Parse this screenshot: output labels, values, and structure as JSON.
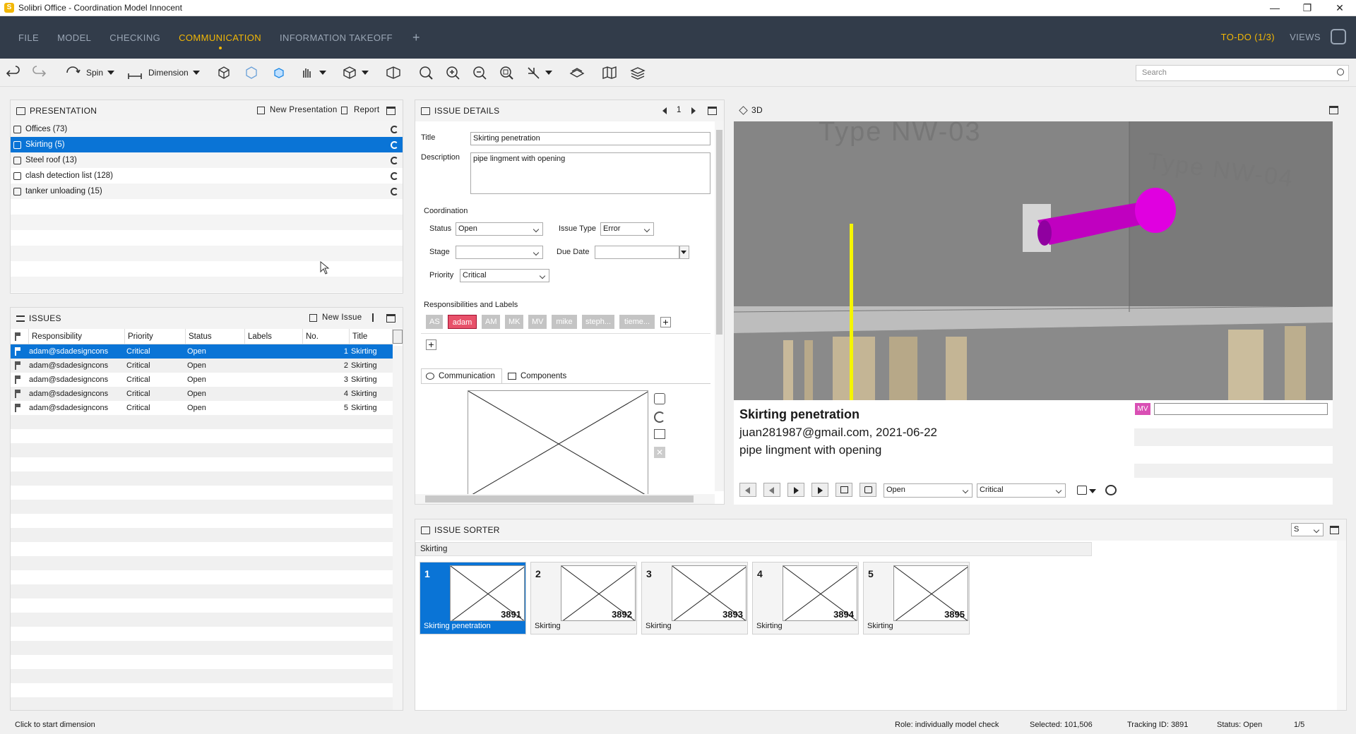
{
  "window": {
    "title": "Solibri Office - Coordination Model Innocent",
    "logo_letter": "S"
  },
  "menu": {
    "items": [
      "FILE",
      "MODEL",
      "CHECKING",
      "COMMUNICATION",
      "INFORMATION TAKEOFF"
    ],
    "active": "COMMUNICATION",
    "plus": "+",
    "todo": "TO-DO (1/3)",
    "views": "VIEWS"
  },
  "toolbar": {
    "spin_label": "Spin",
    "dimension_label": "Dimension",
    "search_placeholder": "Search"
  },
  "presentation": {
    "header": "PRESENTATION",
    "new_label": "New Presentation",
    "report_label": "Report",
    "items": [
      {
        "label": "Offices (73)"
      },
      {
        "label": "Skirting (5)"
      },
      {
        "label": "Steel roof (13)"
      },
      {
        "label": "clash detection list (128)"
      },
      {
        "label": "tanker unloading (15)"
      }
    ],
    "selected_index": 1
  },
  "issues": {
    "header": "ISSUES",
    "new_label": "New Issue",
    "columns": [
      "Responsibility",
      "Priority",
      "Status",
      "Labels",
      "No.",
      "Title"
    ],
    "rows": [
      {
        "responsibility": "adam@sdadesigncons",
        "priority": "Critical",
        "status": "Open",
        "labels": "",
        "no": "1",
        "title": "Skirting"
      },
      {
        "responsibility": "adam@sdadesigncons",
        "priority": "Critical",
        "status": "Open",
        "labels": "",
        "no": "2",
        "title": "Skirting"
      },
      {
        "responsibility": "adam@sdadesigncons",
        "priority": "Critical",
        "status": "Open",
        "labels": "",
        "no": "3",
        "title": "Skirting"
      },
      {
        "responsibility": "adam@sdadesigncons",
        "priority": "Critical",
        "status": "Open",
        "labels": "",
        "no": "4",
        "title": "Skirting"
      },
      {
        "responsibility": "adam@sdadesigncons",
        "priority": "Critical",
        "status": "Open",
        "labels": "",
        "no": "5",
        "title": "Skirting"
      }
    ]
  },
  "details": {
    "header": "ISSUE DETAILS",
    "page": "1",
    "title_label": "Title",
    "title_value": "Skirting penetration",
    "description_label": "Description",
    "description_value": "pipe lingment with opening",
    "coordination_label": "Coordination",
    "status_label": "Status",
    "status_value": "Open",
    "issue_type_label": "Issue Type",
    "issue_type_value": "Error",
    "stage_label": "Stage",
    "stage_value": "",
    "due_date_label": "Due Date",
    "due_date_value": "",
    "priority_label": "Priority",
    "priority_value": "Critical",
    "responsibilities_label": "Responsibilities and Labels",
    "tags": [
      "AS",
      "adam",
      "AM",
      "MK",
      "MV",
      "mike",
      "steph...",
      "tieme..."
    ],
    "active_tag": "adam",
    "tab_communication": "Communication",
    "tab_components": "Components"
  },
  "view3d": {
    "header": "3D",
    "wall_text_top": "Type NW-03",
    "wall_text_right": "Type NW-04",
    "colors": {
      "pipe": "#cc00cc",
      "marker": "#ffff00"
    }
  },
  "issue_info": {
    "title": "Skirting penetration",
    "author_date": "juan281987@gmail.com, 2021-06-22",
    "description": "pipe lingment with opening",
    "status": "Open",
    "priority": "Critical",
    "comment_tag": "MV"
  },
  "sorter": {
    "header": "ISSUE SORTER",
    "size_value": "S",
    "group_label": "Skirting",
    "cards": [
      {
        "num": "1",
        "id": "3891",
        "label": "Skirting penetration"
      },
      {
        "num": "2",
        "id": "3892",
        "label": "Skirting"
      },
      {
        "num": "3",
        "id": "3893",
        "label": "Skirting"
      },
      {
        "num": "4",
        "id": "3894",
        "label": "Skirting"
      },
      {
        "num": "5",
        "id": "3895",
        "label": "Skirting"
      }
    ]
  },
  "status": {
    "hint": "Click to start dimension",
    "role": "Role: individually model check",
    "selected": "Selected: 101,506",
    "tracking": "Tracking ID: 3891",
    "issue_status": "Status: Open",
    "count": "1/5"
  }
}
